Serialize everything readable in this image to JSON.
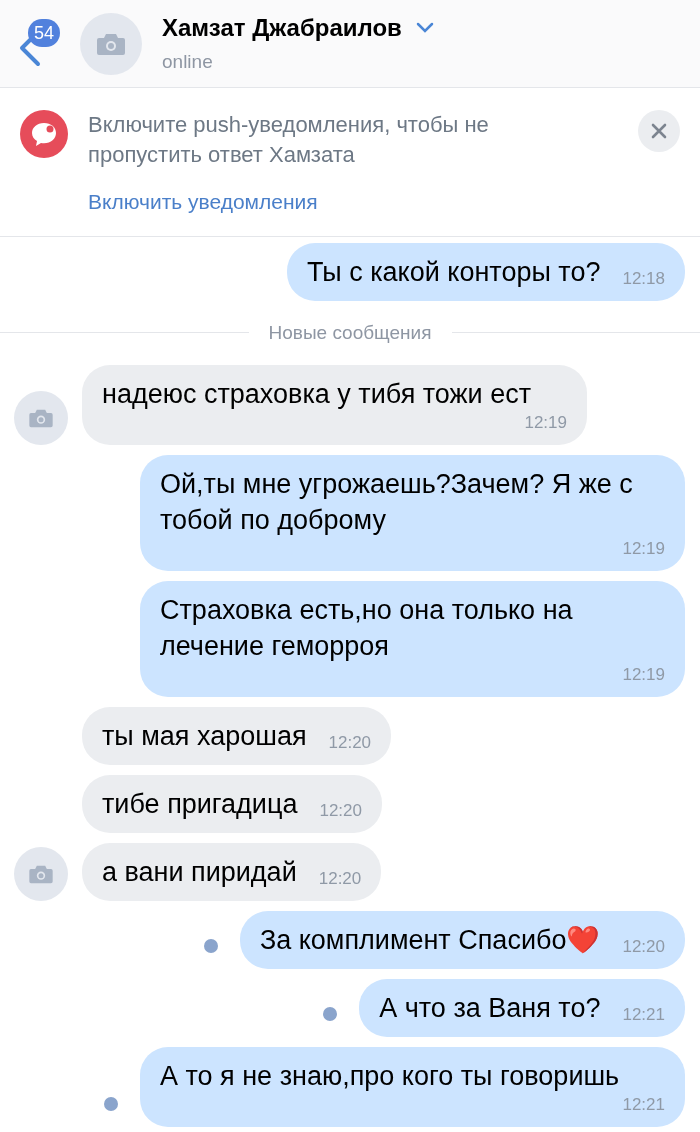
{
  "header": {
    "unread_count": "54",
    "name": "Хамзат Джабраилов",
    "status": "online"
  },
  "notice": {
    "text": "Включите push-уведомления, чтобы не пропустить ответ Хамзата",
    "action": "Включить уведомления"
  },
  "messages": [
    {
      "kind": "outgoing",
      "text": "Ты с какой конторы то?",
      "time": "12:18",
      "unread": false
    },
    {
      "kind": "divider",
      "text": "Новые сообщения"
    },
    {
      "kind": "incoming",
      "text": "надеюс страховка у тибя тожи ест",
      "time": "12:19",
      "avatar": true
    },
    {
      "kind": "outgoing",
      "text": "Ой,ты мне угрожаешь?Зачем? Я же с тобой по доброму",
      "time": "12:19",
      "unread": false
    },
    {
      "kind": "outgoing",
      "text": "Страховка есть,но она только на лечение геморроя",
      "time": "12:19",
      "unread": false
    },
    {
      "kind": "incoming",
      "text": "ты мая харошая",
      "time": "12:20",
      "avatar": false
    },
    {
      "kind": "incoming",
      "text": "тибе пригадица",
      "time": "12:20",
      "avatar": false
    },
    {
      "kind": "incoming",
      "text": "а вани пиридай",
      "time": "12:20",
      "avatar": true
    },
    {
      "kind": "outgoing",
      "text": "За комплимент Спасибо❤️",
      "time": "12:20",
      "unread": true
    },
    {
      "kind": "outgoing",
      "text": "А что за Ваня то?",
      "time": "12:21",
      "unread": true
    },
    {
      "kind": "outgoing",
      "text": "А то я не знаю,про кого ты говоришь",
      "time": "12:21",
      "unread": true
    }
  ]
}
